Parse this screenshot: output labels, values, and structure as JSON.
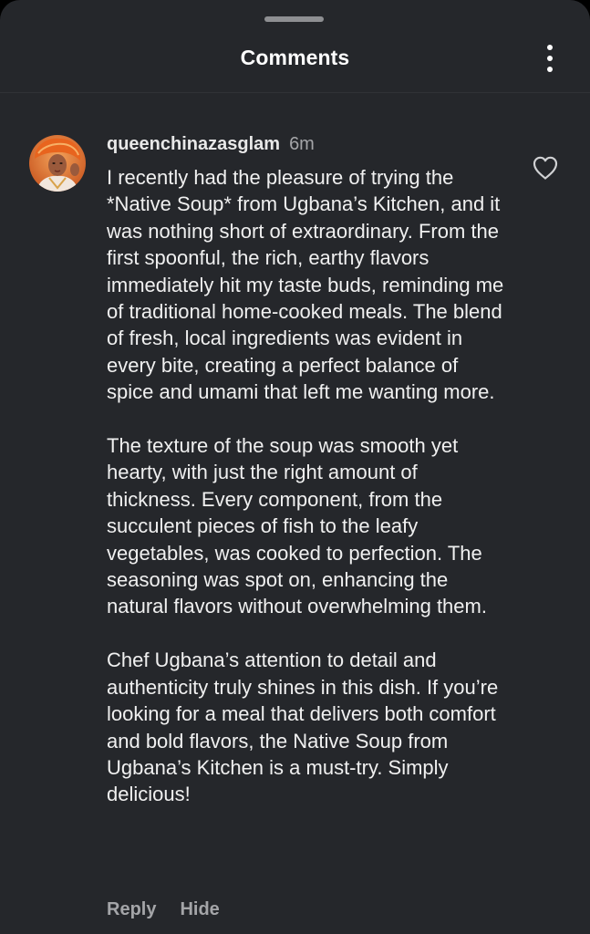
{
  "header": {
    "title": "Comments"
  },
  "comment": {
    "username": "queenchinazasglam",
    "timestamp": "6m",
    "paragraphs": [
      "I recently had the pleasure of trying the *Native Soup* from Ugbana’s Kitchen, and it was nothing short of extraordinary. From the first spoonful, the rich, earthy flavors immediately hit my taste buds, reminding me of traditional home-cooked meals. The blend of fresh, local ingredients was evident in every bite, creating a perfect balance of spice and umami that left me wanting more.",
      "The texture of the soup was smooth yet hearty, with just the right amount of thickness. Every component, from the succulent pieces of fish to the leafy vegetables, was cooked to perfection. The seasoning was spot on, enhancing the natural flavors without overwhelming them.",
      "Chef Ugbana’s attention to detail and authenticity truly shines in this dish. If you’re looking for a meal that delivers both comfort and bold flavors, the Native Soup from Ugbana’s Kitchen is a must-try. Simply delicious!"
    ],
    "reply_label": "Reply",
    "hide_label": "Hide"
  },
  "icons": {
    "more": "more-vertical-icon",
    "like": "heart-outline-icon",
    "avatar": "user-avatar"
  },
  "colors": {
    "background": "#25272b",
    "text": "#f0f0f0",
    "muted": "#a4a5a8",
    "avatar_accent": "#e8641e"
  }
}
